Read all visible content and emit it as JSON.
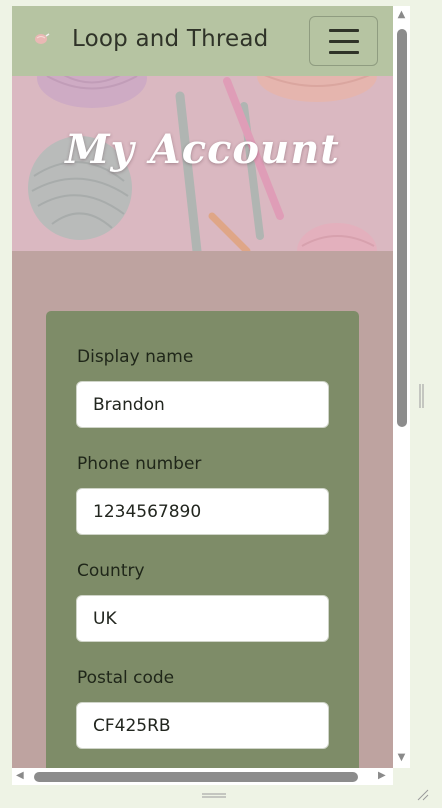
{
  "navbar": {
    "brand": "Loop and Thread",
    "logo_icon": "yarn-ball-icon",
    "menu_icon": "hamburger-menu-icon"
  },
  "hero": {
    "title": "My Account",
    "image": "yarn-and-crochet-hooks-photo"
  },
  "form": {
    "fields": [
      {
        "label": "Display name",
        "value": "Brandon"
      },
      {
        "label": "Phone number",
        "value": "1234567890"
      },
      {
        "label": "Country",
        "value": "UK"
      },
      {
        "label": "Postal code",
        "value": "CF425RB"
      }
    ]
  },
  "colors": {
    "navbar": "#b6c4a2",
    "page_background": "#bea3a0",
    "card": "#7e8c68",
    "hero_overlay": "#d9b9bf"
  }
}
